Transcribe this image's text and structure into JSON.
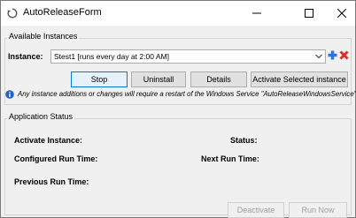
{
  "window": {
    "title": "AutoReleaseForm"
  },
  "available_instances": {
    "group_title": "Available Instances",
    "instance_label": "Instance:",
    "selected_instance": "Stest1 [runs every day at 2:00 AM]",
    "buttons": {
      "stop": "Stop",
      "uninstall": "Uninstall",
      "details": "Details",
      "activate_selected": "Activate Selected instance"
    },
    "info_note": "Any instance additions or changes will require a restart of the Windows Service \"AutoReleaseWindowsService\"."
  },
  "application_status": {
    "group_title": "Application Status",
    "activate_instance_label": "Activate Instance:",
    "status_label": "Status:",
    "configured_run_time_label": "Configured Run Time:",
    "next_run_time_label": "Next Run Time:",
    "previous_run_time_label": "Previous Run Time:",
    "buttons": {
      "deactivate": "Deactivate",
      "run_now": "Run Now"
    }
  },
  "icons": {
    "app": "app-icon",
    "add": "plus-icon",
    "delete": "x-icon",
    "info": "info-icon"
  },
  "colors": {
    "add": "#2e75d6",
    "delete": "#d9302c",
    "info": "#1e64c8",
    "focus": "#0078d7"
  }
}
